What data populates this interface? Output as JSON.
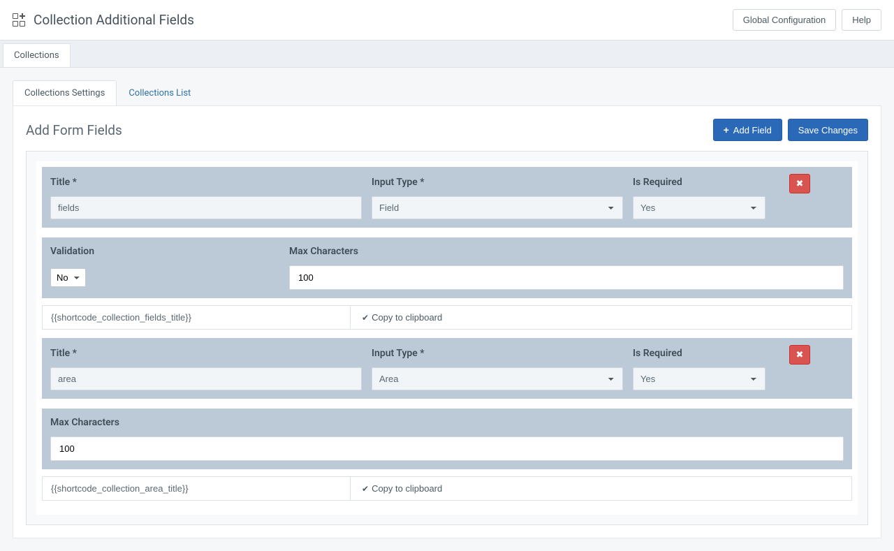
{
  "header": {
    "title": "Collection Additional Fields",
    "global_config": "Global Configuration",
    "help": "Help"
  },
  "tabs1": {
    "collections": "Collections"
  },
  "tabs2": {
    "settings": "Collections Settings",
    "list": "Collections List"
  },
  "panel": {
    "title": "Add Form Fields",
    "add_field": "Add Field",
    "save": "Save Changes"
  },
  "labels": {
    "title": "Title *",
    "input_type": "Input Type *",
    "is_required": "Is Required",
    "validation": "Validation",
    "max_chars": "Max Characters",
    "copy": "Copy to clipboard"
  },
  "fields": [
    {
      "title_value": "fields",
      "type_value": "Field",
      "required_value": "Yes",
      "has_validation": true,
      "validation_value": "No",
      "max_chars_value": "100",
      "shortcode": "{{shortcode_collection_fields_title}}"
    },
    {
      "title_value": "area",
      "type_value": "Area",
      "required_value": "Yes",
      "has_validation": false,
      "max_chars_value": "100",
      "shortcode": "{{shortcode_collection_area_title}}"
    }
  ]
}
